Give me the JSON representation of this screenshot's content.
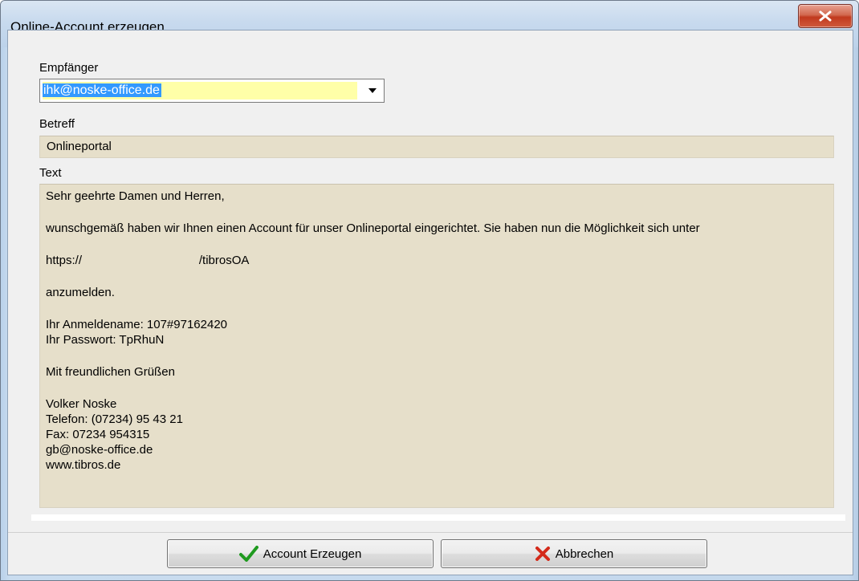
{
  "window": {
    "title": "Online-Account erzeugen",
    "close_icon": "close-x-icon"
  },
  "form": {
    "recipient_label": "Empfänger",
    "recipient_value": "ihk@noske-office.de",
    "subject_label": "Betreff",
    "subject_value": "Onlineportal",
    "text_label": "Text",
    "text_lines": {
      "salutation": "Sehr geehrte Damen und Herren,",
      "intro": "wunschgemäß haben wir Ihnen einen Account für unser Onlineportal eingerichtet. Sie haben nun die Möglichkeit sich unter",
      "url": "https://                                   /tibrosOA",
      "login_prompt": "anzumelden.",
      "username": "Ihr Anmeldename: 107#97162420",
      "password": "Ihr Passwort: TpRhuN",
      "closing": "Mit freundlichen Grüßen",
      "sig_name": "Volker Noske",
      "sig_phone": "Telefon: (07234) 95 43 21",
      "sig_fax": "Fax: 07234 954315",
      "sig_email": "gb@noske-office.de",
      "sig_web": "www.tibros.de"
    }
  },
  "buttons": {
    "create_label": "Account Erzeugen",
    "create_icon": "checkmark-icon",
    "cancel_label": "Abbrechen",
    "cancel_icon": "red-x-icon"
  },
  "colors": {
    "field_background": "#e6dfca",
    "selection_highlight": "#3399ff",
    "combo_background": "#ffffa8",
    "close_button": "#c1391e"
  }
}
